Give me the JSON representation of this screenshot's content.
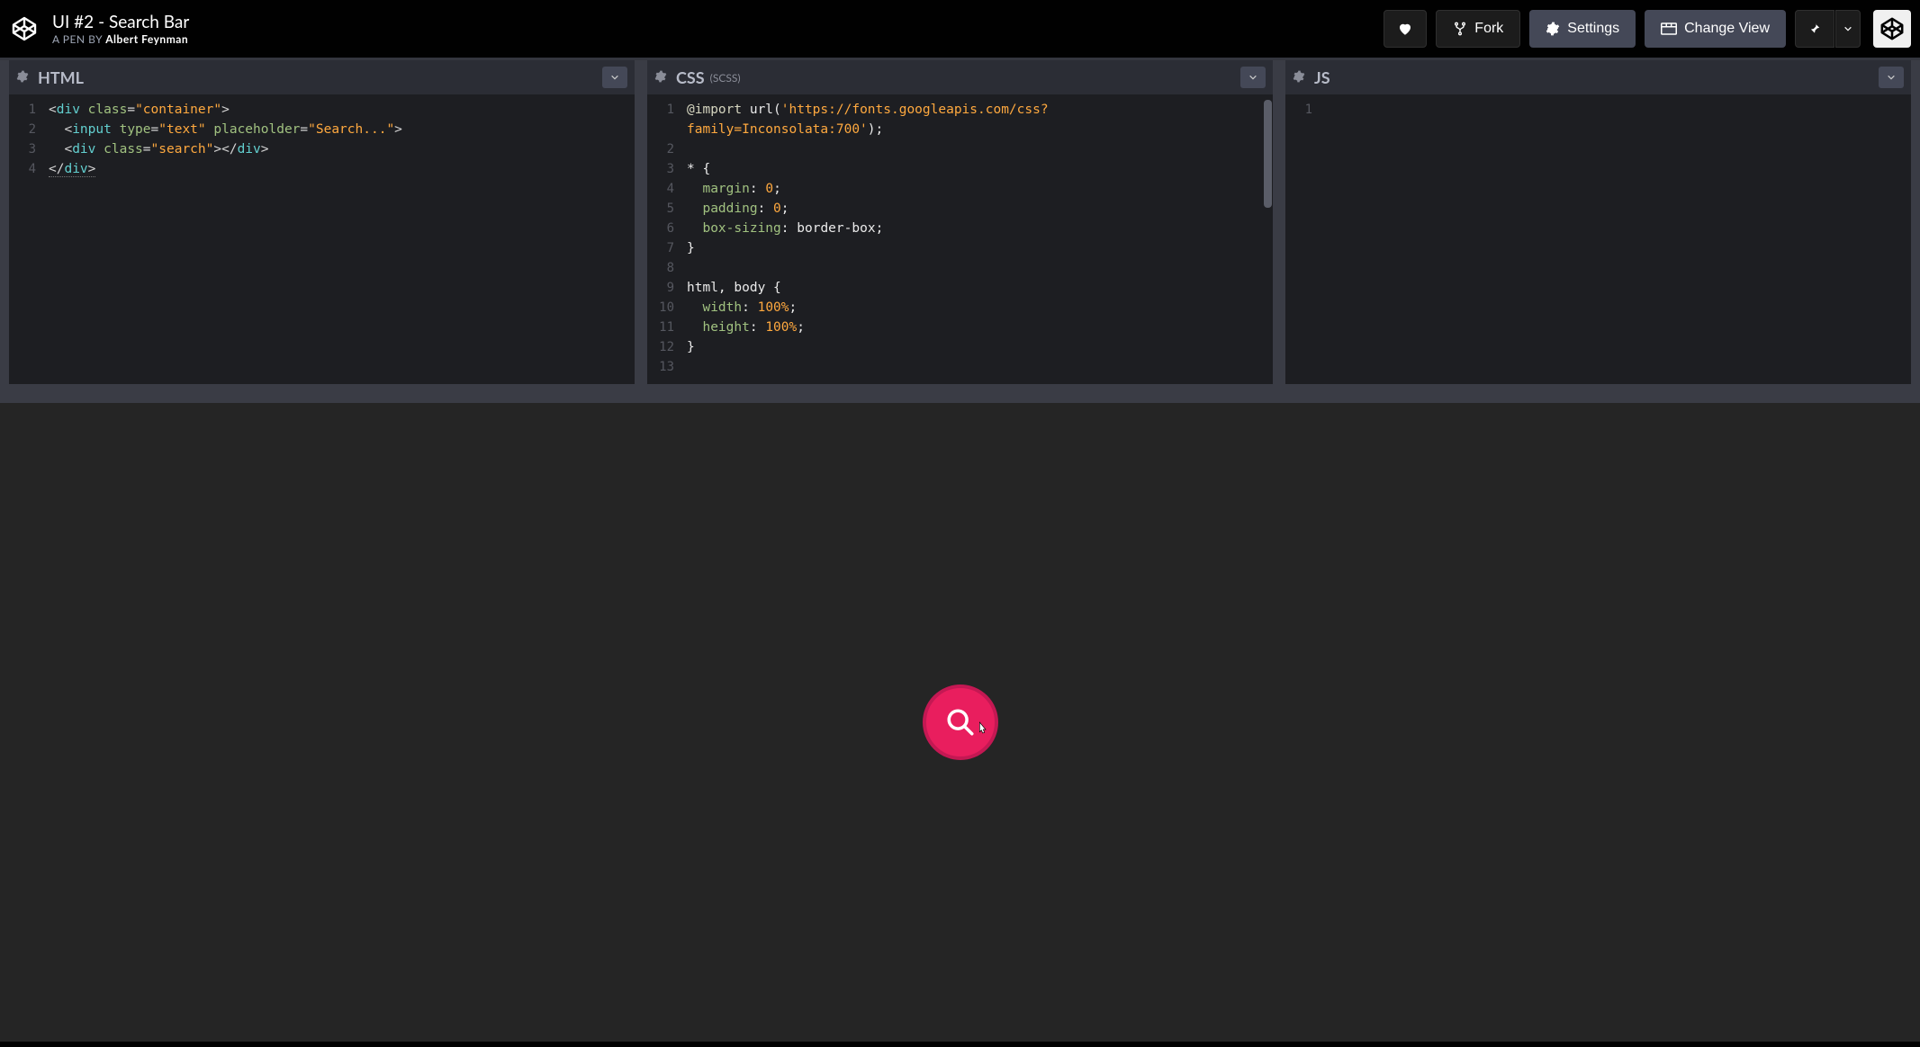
{
  "header": {
    "title": "UI #2 - Search Bar",
    "byline_prefix": "A PEN BY ",
    "author": "Albert Feynman",
    "buttons": {
      "fork": "Fork",
      "settings": "Settings",
      "change_view": "Change View"
    }
  },
  "editors": {
    "html": {
      "title": "HTML",
      "lines": [
        {
          "n": "1",
          "html": "<span class='t-punc'>&lt;</span><span class='t-tag'>div</span> <span class='t-attr'>class</span><span class='t-punc'>=</span><span class='t-str'>\"container\"</span><span class='t-punc'>&gt;</span>"
        },
        {
          "n": "2",
          "html": "  <span class='t-punc'>&lt;</span><span class='t-tag'>input</span> <span class='t-attr'>type</span><span class='t-punc'>=</span><span class='t-str'>\"text\"</span> <span class='t-attr'>placeholder</span><span class='t-punc'>=</span><span class='t-str'>\"Search...\"</span><span class='t-punc'>&gt;</span>"
        },
        {
          "n": "3",
          "html": "  <span class='t-punc'>&lt;</span><span class='t-tag'>div</span> <span class='t-attr'>class</span><span class='t-punc'>=</span><span class='t-str'>\"search\"</span><span class='t-punc'>&gt;&lt;/</span><span class='t-tag'>div</span><span class='t-punc'>&gt;</span>"
        },
        {
          "n": "4",
          "html": "<span class='t-wave'><span class='t-punc'>&lt;/</span><span class='t-tag'>div</span><span class='t-punc'>&gt;</span></span>"
        }
      ]
    },
    "css": {
      "title": "CSS",
      "subtitle": "(SCSS)",
      "lines": [
        {
          "n": "1",
          "html": "<span class='t-imp'>@import</span> <span class='t-sel'>url(</span><span class='t-str'>'https://fonts.googleapis.com/css?</span>"
        },
        {
          "n": "",
          "html": "<span class='t-str'>family=Inconsolata:700'</span><span class='t-sel'>);</span>"
        },
        {
          "n": "2",
          "html": ""
        },
        {
          "n": "3",
          "html": "<span class='t-sel'>* {</span>"
        },
        {
          "n": "4",
          "html": "  <span class='t-prop'>margin</span><span class='t-sel'>:</span> <span class='t-num'>0</span><span class='t-sel'>;</span>"
        },
        {
          "n": "5",
          "html": "  <span class='t-prop'>padding</span><span class='t-sel'>:</span> <span class='t-num'>0</span><span class='t-sel'>;</span>"
        },
        {
          "n": "6",
          "html": "  <span class='t-prop'>box-sizing</span><span class='t-sel'>:</span> <span class='t-sel'>border-box</span><span class='t-sel'>;</span>"
        },
        {
          "n": "7",
          "html": "<span class='t-sel'>}</span>"
        },
        {
          "n": "8",
          "html": ""
        },
        {
          "n": "9",
          "html": "<span class='t-sel'>html, body {</span>"
        },
        {
          "n": "10",
          "html": "  <span class='t-prop'>width</span><span class='t-sel'>:</span> <span class='t-num'>100%</span><span class='t-sel'>;</span>"
        },
        {
          "n": "11",
          "html": "  <span class='t-prop'>height</span><span class='t-sel'>:</span> <span class='t-num'>100%</span><span class='t-sel'>;</span>"
        },
        {
          "n": "12",
          "html": "<span class='t-sel'>}</span>"
        },
        {
          "n": "13",
          "html": ""
        }
      ]
    },
    "js": {
      "title": "JS",
      "lines": [
        {
          "n": "1",
          "html": ""
        }
      ]
    }
  }
}
